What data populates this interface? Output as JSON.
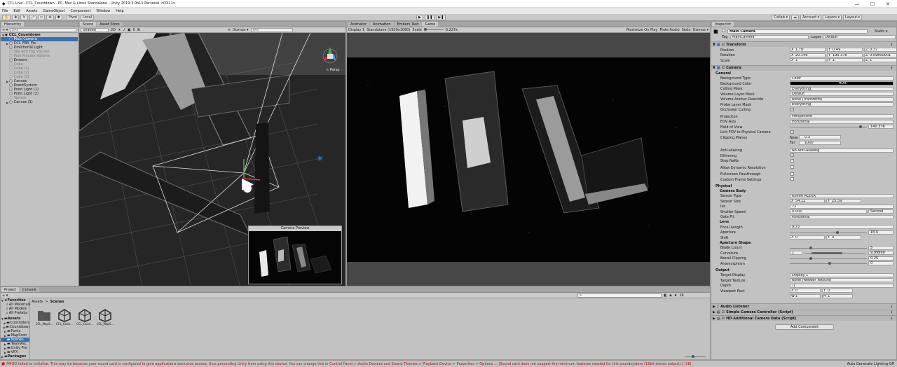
{
  "window": {
    "title": "CCL Live - CCL_Countdown - PC, Mac & Linux Standalone - Unity 2019.3.0b11 Personal <DX11>",
    "min": "—",
    "max": "☐",
    "close": "✕"
  },
  "menu": [
    "File",
    "Edit",
    "Assets",
    "GameObject",
    "Component",
    "Window",
    "Help"
  ],
  "toolbar": {
    "pivot": "Pivot",
    "local": "Local",
    "collab": "Collab ▾",
    "account": "Account ▾",
    "layers": "Layers ▾",
    "layout": "Layout ▾"
  },
  "hierarchy": {
    "tab": "Hierarchy",
    "create": "+ ▾",
    "search_placeholder": "All",
    "items": [
      {
        "label": "CCL_Countdown",
        "indent": 0,
        "tri": "▼",
        "sel": false,
        "grey": false,
        "bold": true
      },
      {
        "label": "Main Camera",
        "indent": 1,
        "tri": "",
        "sel": true,
        "grey": false
      },
      {
        "label": "CCL_FBX_Fix",
        "indent": 1,
        "tri": "▶",
        "sel": false,
        "grey": false
      },
      {
        "label": "Directional Light",
        "indent": 1,
        "tri": "",
        "sel": false,
        "grey": false
      },
      {
        "label": "Sky and Fog Volume",
        "indent": 1,
        "tri": "",
        "sel": false,
        "grey": true
      },
      {
        "label": "Post Process Volume",
        "indent": 1,
        "tri": "",
        "sel": false,
        "grey": true
      },
      {
        "label": "Embers",
        "indent": 1,
        "tri": "",
        "sel": false,
        "grey": false
      },
      {
        "label": "Cube",
        "indent": 1,
        "tri": "",
        "sel": false,
        "grey": true
      },
      {
        "label": "Cube (1)",
        "indent": 1,
        "tri": "",
        "sel": false,
        "grey": true
      },
      {
        "label": "Cube (2)",
        "indent": 1,
        "tri": "",
        "sel": false,
        "grey": true
      },
      {
        "label": "Cube (3)",
        "indent": 1,
        "tri": "",
        "sel": false,
        "grey": true
      },
      {
        "label": "Canvas",
        "indent": 1,
        "tri": "▶",
        "sel": false,
        "grey": false
      },
      {
        "label": "EventSystem",
        "indent": 1,
        "tri": "",
        "sel": false,
        "grey": false
      },
      {
        "label": "Point Light (1)",
        "indent": 1,
        "tri": "",
        "sel": false,
        "grey": false
      },
      {
        "label": "Point Light (2)",
        "indent": 1,
        "tri": "",
        "sel": false,
        "grey": false
      },
      {
        "label": "Sphere",
        "indent": 1,
        "tri": "",
        "sel": false,
        "grey": true
      },
      {
        "label": "Canvas (1)",
        "indent": 1,
        "tri": "▶",
        "sel": false,
        "grey": false
      }
    ]
  },
  "scene": {
    "tab": "Scene",
    "tab2": "Asset Store",
    "shading": "Shaded",
    "mode2d": "2D",
    "gizmos": "Gizmos ▾",
    "search_placeholder": "All",
    "persp": "< Persp",
    "preview_title": "Camera Preview",
    "counter": "0"
  },
  "game": {
    "tabs": [
      "Animator",
      "Animation",
      "Embers_Red",
      "Game"
    ],
    "display": "Display 1",
    "resolution": "Standalone (1920x1080)",
    "scale_label": "Scale",
    "scale_value": "0.227x",
    "options": [
      "Maximize On Play",
      "Mute Audio",
      "Stats",
      "Gizmos ▾"
    ]
  },
  "inspector": {
    "tab": "Inspector",
    "object_name": "Main Camera",
    "static": "Static ▾",
    "tag_label": "Tag",
    "tag": "MainCamera",
    "layer_label": "Layer",
    "layer": "Default",
    "transform": {
      "title": "Transform",
      "rows": [
        {
          "label": "Position",
          "x": "1.78",
          "y": "0.49",
          "z": "0.37"
        },
        {
          "label": "Rotation",
          "x": "20.146",
          "y": "195.376",
          "z": "0.09800001"
        },
        {
          "label": "Scale",
          "x": "1",
          "y": "1",
          "z": "1"
        }
      ]
    },
    "camera": {
      "title": "Camera",
      "general": "General",
      "rows": [
        {
          "label": "Background Type",
          "value": "Color"
        },
        {
          "label": "Background Color",
          "value": "HDR"
        },
        {
          "label": "Culling Mask",
          "value": "Everything"
        },
        {
          "label": "Volume Layer Mask",
          "value": "Default"
        },
        {
          "label": "Volume Anchor Override",
          "value": "None (Transform)"
        },
        {
          "label": "Probe Layer Mask",
          "value": "Everything"
        },
        {
          "label": "Occlusion Culling",
          "value": "✓"
        },
        {
          "label": "Projection",
          "value": "Perspective"
        },
        {
          "label": "FOV Axis",
          "value": "Horizontal"
        },
        {
          "label": "Field of View",
          "value": "140.376"
        },
        {
          "label": "Link FOV to Physical Camera",
          "value": "✓"
        },
        {
          "label": "Clipping Planes",
          "near_label": "Near",
          "near": "0.3",
          "far_label": "Far",
          "far": "1000"
        },
        {
          "label": "Anti-aliasing",
          "value": "No Anti-aliasing"
        },
        {
          "label": "Dithering",
          "value": "✓"
        },
        {
          "label": "Stop NaNs",
          "value": ""
        },
        {
          "label": "Allow Dynamic Resolution",
          "value": ""
        },
        {
          "label": "Fullscreen Passthrough",
          "value": ""
        },
        {
          "label": "Custom Frame Settings",
          "value": ""
        }
      ],
      "physical": "Physical",
      "camera_body": "Camera Body",
      "sensor_type_label": "Sensor Type",
      "sensor_type": "65mm ALEXA",
      "sensor_size_label": "Sensor Size",
      "sensor_x": "54.12",
      "sensor_y": "25.59",
      "iso_label": "Iso",
      "iso": "72",
      "shutter_label": "Shutter Speed",
      "shutter": "0.005",
      "shutter_unit": "Second",
      "gate_label": "Gate Fit",
      "gate": "Horizontal",
      "lens": "Lens",
      "focal_label": "Focal Length",
      "focal": "9.75",
      "aperture_label": "Aperture",
      "aperture": "18.6",
      "shift_label": "Shift",
      "shift_x": "0",
      "shift_y": "0",
      "aperture_shape": "Aperture Shape",
      "blade_label": "Blade Count",
      "blade": "5",
      "curvature_label": "Curvature",
      "curv_min": "1",
      "curv_max": "9.99999",
      "barrel_label": "Barrel Clipping",
      "barrel": "0.25",
      "anamorph_label": "Anamorphism",
      "anamorph": "0",
      "output": "Output",
      "target_display_label": "Target Display",
      "target_display": "Display 1",
      "target_texture_label": "Target Texture",
      "target_texture": "None (Render Texture)",
      "depth_label": "Depth",
      "depth": "-1",
      "viewport_label": "Viewport Rect",
      "vx": "0",
      "vy": "0",
      "vw": "1",
      "vh": "1"
    },
    "components": [
      "Audio Listener",
      "Simple Camera Controller (Script)",
      "HD Additional Camera Data (Script)"
    ],
    "add_component": "Add Component"
  },
  "project": {
    "tabs": [
      "Project",
      "Console"
    ],
    "favorites_label": "Favorites",
    "favorites": [
      "All Materials",
      "All Models",
      "All Prefabs"
    ],
    "assets_label": "Assets",
    "assets": [
      "Controllers",
      "Countdown",
      "Fonts",
      "MapScon",
      "Scenes",
      "TeamAsc",
      "Unity Pre",
      "VFX"
    ],
    "packages": "Packages",
    "breadcrumb_root": "Assets",
    "breadcrumb_sep": ">",
    "breadcrumb_leaf": "Scenes",
    "files": [
      "CCL_MapS...",
      "CCL_Contr...",
      "CCL_Coun...",
      "CCL_MapS..."
    ],
    "count": "16"
  },
  "status": {
    "message": "FMOD failed to initialize. This may be because your sound card is configured to give applications exclusive access, thus preventing Unity from using this device. You can change this in Control Panel > Audio Devices and Sound Themes > Playback Device > Properties > Options ... [Sound card does not support the minimum features needed for this soundsystem (16bit stereo output).] (18)",
    "right": "Auto Generate Lighting Off"
  }
}
